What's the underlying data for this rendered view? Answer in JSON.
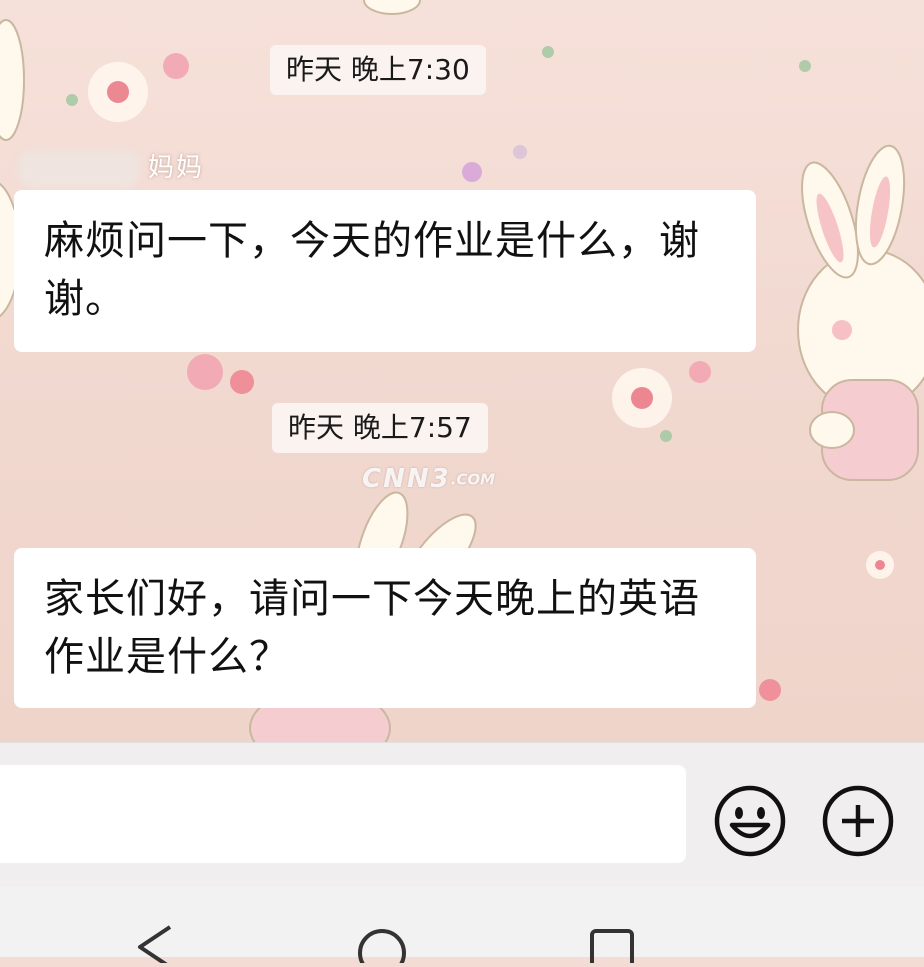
{
  "chat": {
    "messages": [
      {
        "timestamp": "昨天 晚上7:30",
        "sender": "妈妈",
        "text": "麻烦问一下，今天的作业是什么，谢谢。"
      },
      {
        "timestamp": "昨天 晚上7:57",
        "sender": "",
        "text": "家长们好，请问一下今天晚上的英语作业是什么？"
      }
    ]
  },
  "watermark": {
    "text": "CNN3",
    "suffix": ".COM"
  },
  "input_bar": {
    "value": "",
    "placeholder": ""
  },
  "icons": {
    "emoji": "emoji-icon",
    "plus": "plus-icon",
    "back": "back-triangle-icon",
    "home": "home-circle-icon",
    "recent": "recent-square-icon"
  },
  "colors": {
    "wallpaper": "#f3dcd4",
    "bubble": "#ffffff",
    "input_bar": "#f0eeee"
  }
}
